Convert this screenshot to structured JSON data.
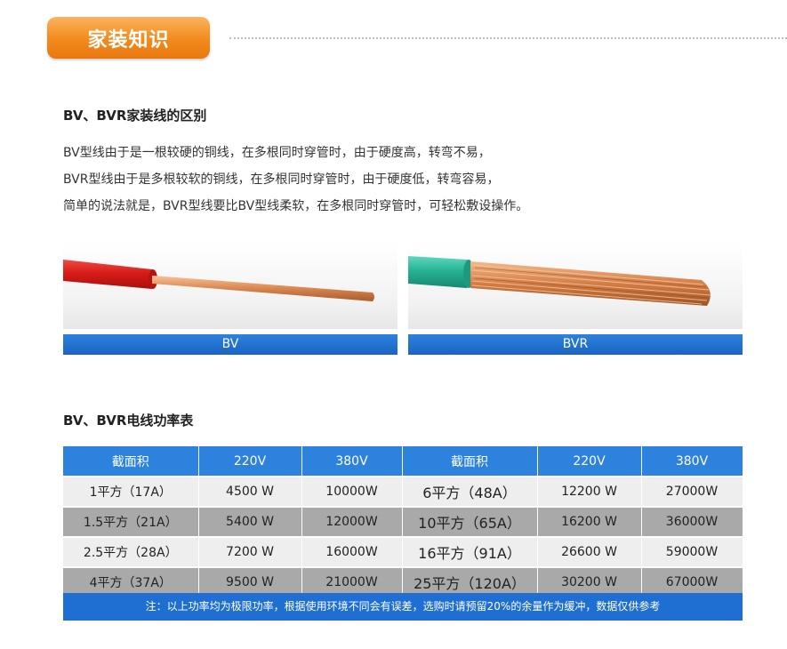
{
  "header": {
    "title": "家装知识"
  },
  "section1": {
    "title": "BV、BVR家装线的区别",
    "lines": [
      "BV型线由于是一根较硬的铜线，在多根同时穿管时，由于硬度高，转弯不易，",
      "BVR型线由于是多根较软的铜线，在多根同时穿管时，由于硬度低，转弯容易，",
      "简单的说法就是，BVR型线要比BV型线柔软，在多根同时穿管时，可轻松敷设操作。"
    ]
  },
  "images": [
    {
      "label": "BV",
      "insulation_color": "#e0201e"
    },
    {
      "label": "BVR",
      "insulation_color": "#28b79a"
    }
  ],
  "section2": {
    "title": "BV、BVR电线功率表",
    "headers": [
      "截面积",
      "220V",
      "380V",
      "截面积",
      "220V",
      "380V"
    ],
    "rows": [
      [
        "1平方（17A）",
        "4500 W",
        "10000W",
        "6平方（48A）",
        "12200 W",
        "27000W"
      ],
      [
        "1.5平方（21A）",
        "5400 W",
        "12000W",
        "10平方（65A）",
        "16200 W",
        "36000W"
      ],
      [
        "2.5平方（28A）",
        "7200 W",
        "16000W",
        "16平方（91A）",
        "26600 W",
        "59000W"
      ],
      [
        "4平方（37A）",
        "9500 W",
        "21000W",
        "25平方（120A）",
        "30200 W",
        "67000W"
      ]
    ],
    "note": "注：以上功率均为极限功率，根据使用环境不同会有误差，选购时请预留20%的余量作为缓冲，数据仅供参考"
  }
}
